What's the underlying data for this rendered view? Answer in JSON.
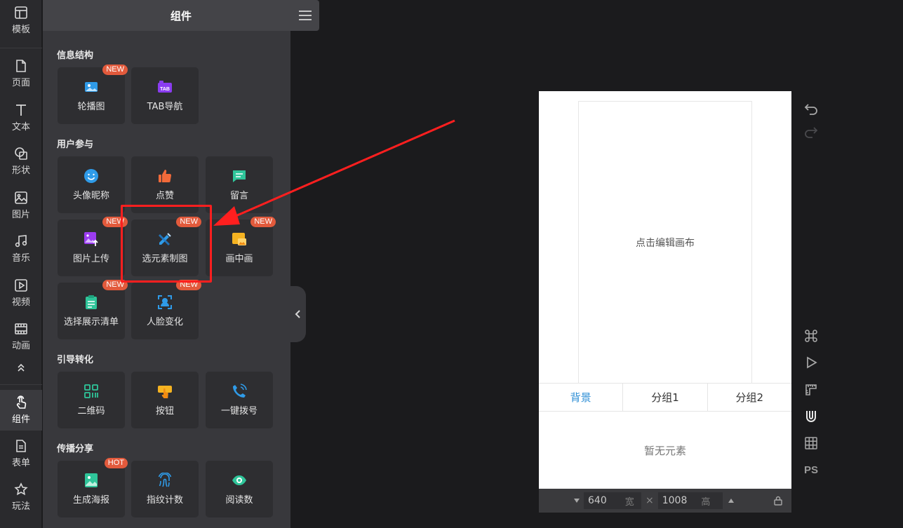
{
  "rail": {
    "items": [
      {
        "label": "模板"
      },
      {
        "label": "页面"
      },
      {
        "label": "文本"
      },
      {
        "label": "形状"
      },
      {
        "label": "图片"
      },
      {
        "label": "音乐"
      },
      {
        "label": "视频"
      },
      {
        "label": "动画"
      },
      {
        "label": "组件",
        "active": true
      },
      {
        "label": "表单"
      },
      {
        "label": "玩法"
      }
    ]
  },
  "panel": {
    "title": "组件",
    "sections": [
      {
        "title": "信息结构",
        "tiles": [
          {
            "label": "轮播图",
            "badge": "NEW",
            "icon": "image-carousel-icon"
          },
          {
            "label": "TAB导航",
            "icon": "tab-icon",
            "icon_text": "TAB"
          }
        ]
      },
      {
        "title": "用户参与",
        "tiles": [
          {
            "label": "头像昵称",
            "icon": "smile-icon"
          },
          {
            "label": "点赞",
            "icon": "thumbs-up-icon"
          },
          {
            "label": "留言",
            "icon": "comment-icon"
          },
          {
            "label": "图片上传",
            "badge": "NEW",
            "icon": "image-upload-icon"
          },
          {
            "label": "选元素制图",
            "badge": "NEW",
            "icon": "pencil-ruler-icon"
          },
          {
            "label": "画中画",
            "badge": "NEW",
            "icon": "picture-in-picture-icon"
          },
          {
            "label": "选择展示清单",
            "badge": "NEW",
            "icon": "clipboard-list-icon"
          },
          {
            "label": "人脸变化",
            "badge": "NEW",
            "icon": "face-scan-icon"
          }
        ]
      },
      {
        "title": "引导转化",
        "tiles": [
          {
            "label": "二维码",
            "icon": "qrcode-icon"
          },
          {
            "label": "按钮",
            "icon": "tap-button-icon"
          },
          {
            "label": "一键拨号",
            "icon": "phone-call-icon"
          }
        ]
      },
      {
        "title": "传播分享",
        "tiles": [
          {
            "label": "生成海报",
            "badge": "HOT",
            "icon": "poster-icon"
          },
          {
            "label": "指纹计数",
            "icon": "fingerprint-icon"
          },
          {
            "label": "阅读数",
            "icon": "eye-icon"
          }
        ]
      }
    ]
  },
  "canvas": {
    "hint": "点击编辑画布",
    "group_tabs": [
      {
        "label": "背景",
        "active": true
      },
      {
        "label": "分组1"
      },
      {
        "label": "分组2"
      }
    ],
    "empty_text": "暂无元素",
    "width_value": "640",
    "width_unit": "宽",
    "times": "×",
    "height_value": "1008",
    "height_unit": "高"
  },
  "toolbar": {
    "ps_label": "PS"
  },
  "colors": {
    "accent_blue": "#2f8fd6",
    "badge_red": "#e25a3c",
    "highlight_red": "#ff1f1f"
  }
}
